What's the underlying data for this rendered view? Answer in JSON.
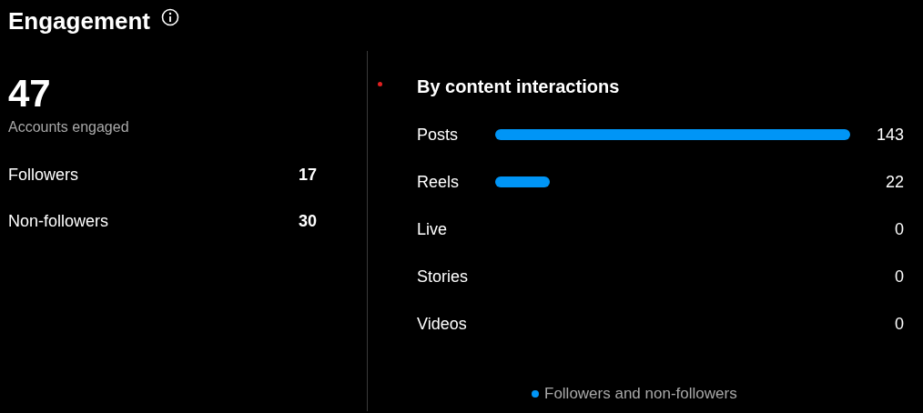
{
  "title": "Engagement",
  "summary": {
    "value": "47",
    "label": "Accounts engaged"
  },
  "breakdown": [
    {
      "label": "Followers",
      "value": "17"
    },
    {
      "label": "Non-followers",
      "value": "30"
    }
  ],
  "content_interactions": {
    "title": "By content interactions",
    "chart_data": {
      "type": "bar",
      "orientation": "horizontal",
      "categories": [
        "Posts",
        "Reels",
        "Live",
        "Stories",
        "Videos"
      ],
      "series": [
        {
          "name": "Followers and non-followers",
          "color": "#0095f6",
          "values": [
            143,
            22,
            0,
            0,
            0
          ]
        }
      ],
      "data_labels": true
    }
  }
}
